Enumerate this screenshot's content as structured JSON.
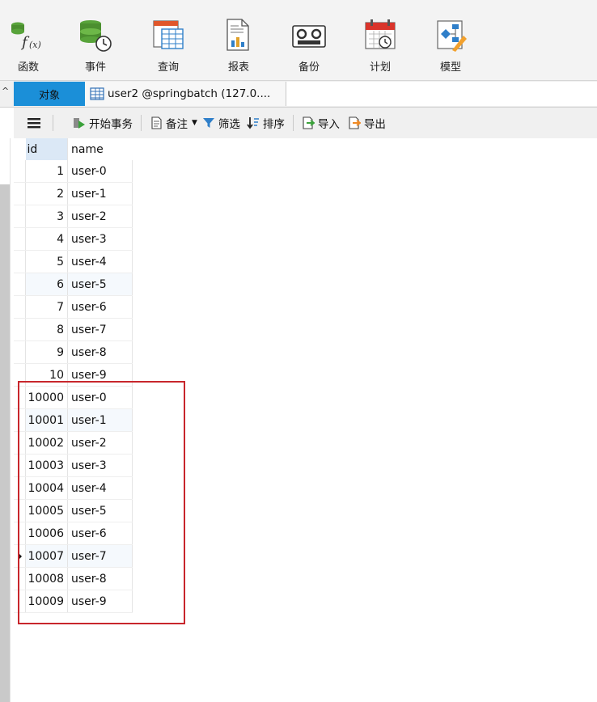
{
  "ribbon": {
    "buttons": [
      {
        "label": "函数",
        "icon": "function-icon"
      },
      {
        "label": "事件",
        "icon": "event-icon"
      },
      {
        "label": "查询",
        "icon": "query-icon"
      },
      {
        "label": "报表",
        "icon": "report-icon"
      },
      {
        "label": "备份",
        "icon": "backup-icon"
      },
      {
        "label": "计划",
        "icon": "schedule-icon"
      },
      {
        "label": "模型",
        "icon": "model-icon"
      }
    ]
  },
  "tabs": {
    "objects_label": "对象",
    "table_tab_label": "user2 @springbatch (127.0...."
  },
  "toolbar": {
    "begin_transaction": "开始事务",
    "memo": "备注",
    "filter": "筛选",
    "sort": "排序",
    "import": "导入",
    "export": "导出"
  },
  "grid": {
    "columns": [
      "id",
      "name"
    ],
    "rows": [
      [
        "1",
        "user-0"
      ],
      [
        "2",
        "user-1"
      ],
      [
        "3",
        "user-2"
      ],
      [
        "4",
        "user-3"
      ],
      [
        "5",
        "user-4"
      ],
      [
        "6",
        "user-5"
      ],
      [
        "7",
        "user-6"
      ],
      [
        "8",
        "user-7"
      ],
      [
        "9",
        "user-8"
      ],
      [
        "10",
        "user-9"
      ],
      [
        "10000",
        "user-0"
      ],
      [
        "10001",
        "user-1"
      ],
      [
        "10002",
        "user-2"
      ],
      [
        "10003",
        "user-3"
      ],
      [
        "10004",
        "user-4"
      ],
      [
        "10005",
        "user-5"
      ],
      [
        "10006",
        "user-6"
      ],
      [
        "10007",
        "user-7"
      ],
      [
        "10008",
        "user-8"
      ],
      [
        "10009",
        "user-9"
      ]
    ],
    "current_row": 17
  },
  "colors": {
    "accent_tab": "#1b8fd8",
    "highlight_box": "#c8262c",
    "header_id_bg": "#dbe8f6"
  }
}
